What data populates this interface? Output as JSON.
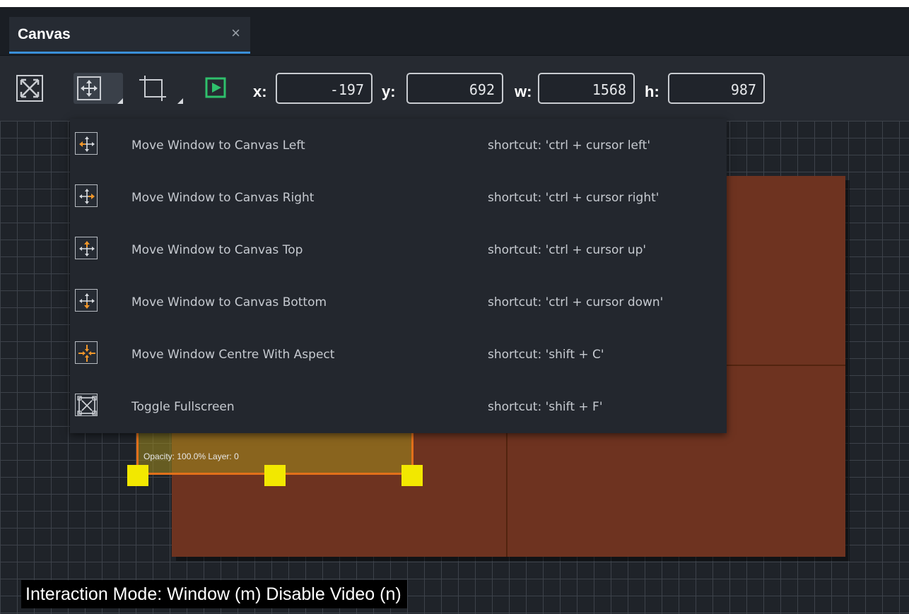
{
  "tab": {
    "title": "Canvas",
    "close_glyph": "×"
  },
  "toolbar": {
    "buttons": [
      {
        "name": "fullscreen-toggle",
        "icon": "expand-icon"
      },
      {
        "name": "move-window",
        "icon": "move-arrows-icon",
        "has_dropdown": true,
        "active": true
      },
      {
        "name": "crop-window",
        "icon": "crop-icon",
        "has_dropdown": true
      },
      {
        "name": "play",
        "icon": "play-icon",
        "color": "#2fc06c"
      }
    ],
    "coords": {
      "x_label": "x:",
      "x_value": "-197",
      "y_label": "y:",
      "y_value": "692",
      "w_label": "w:",
      "w_value": "1568",
      "h_label": "h:",
      "h_value": "987"
    }
  },
  "menu": {
    "items": [
      {
        "label": "Move Window to Canvas Left",
        "shortcut": "shortcut: 'ctrl + cursor left'",
        "icon": "move-left-icon"
      },
      {
        "label": "Move Window to Canvas Right",
        "shortcut": "shortcut: 'ctrl + cursor right'",
        "icon": "move-right-icon"
      },
      {
        "label": "Move Window to Canvas Top",
        "shortcut": "shortcut: 'ctrl + cursor up'",
        "icon": "move-up-icon"
      },
      {
        "label": "Move Window to Canvas Bottom",
        "shortcut": "shortcut: 'ctrl + cursor down'",
        "icon": "move-down-icon"
      },
      {
        "label": "Move Window Centre With Aspect",
        "shortcut": "shortcut: 'shift + C'",
        "icon": "move-centre-icon"
      },
      {
        "label": "Toggle Fullscreen",
        "shortcut": "shortcut: 'shift + F'",
        "icon": "fullscreen-icon"
      }
    ]
  },
  "canvas": {
    "window_info": "Opacity: 100.0% Layer: 0",
    "status": "Interaction Mode: Window (m) Disable Video (n)"
  },
  "colors": {
    "accent_blue": "#3a8fd8",
    "arrow_orange": "#f0962a",
    "play_green": "#2fc06c",
    "handle_yellow": "#f2e800",
    "output_brown": "#6e3320"
  }
}
